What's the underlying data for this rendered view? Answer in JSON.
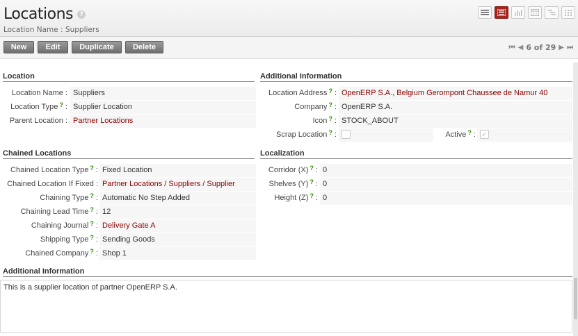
{
  "header": {
    "title": "Locations",
    "help_icon": "?",
    "breadcrumb": "Location Name : Suppliers"
  },
  "view_switcher": [
    "list-view-icon",
    "form-view-icon",
    "graph-view-icon",
    "calendar-view-icon",
    "gantt-view-icon",
    "kanban-view-icon"
  ],
  "toolbar": {
    "new_label": "New",
    "edit_label": "Edit",
    "duplicate_label": "Duplicate",
    "delete_label": "Delete"
  },
  "pager": {
    "first": "⏮",
    "prev": "◀",
    "status": "6 of 29",
    "next": "▶",
    "last": "⏭"
  },
  "location": {
    "section_title": "Location",
    "name_label": "Location Name :",
    "name_value": "Suppliers",
    "type_label": "Location Type",
    "type_value": "Supplier Location",
    "parent_label": "Parent Location :",
    "parent_value": "Partner Locations"
  },
  "additional_info": {
    "section_title": "Additional Information",
    "address_label": "Location Address",
    "address_value": "OpenERP S.A., Belgium Gerompont Chaussee de Namur 40",
    "company_label": "Company",
    "company_value": "OpenERP S.A.",
    "icon_label": "Icon",
    "icon_value": "STOCK_ABOUT",
    "scrap_label": "Scrap Location",
    "scrap_checked": false,
    "active_label": "Active",
    "active_checked": true
  },
  "chained": {
    "section_title": "Chained Locations",
    "type_label": "Chained Location Type",
    "type_value": "Fixed Location",
    "fixed_label": "Chained Location If Fixed :",
    "fixed_value": "Partner Locations / Suppliers / Supplier",
    "chaining_type_label": "Chaining Type",
    "chaining_type_value": "Automatic No Step Added",
    "lead_time_label": "Chaining Lead Time",
    "lead_time_value": "12",
    "journal_label": "Chaining Journal",
    "journal_value": "Delivery Gate A",
    "shipping_label": "Shipping Type",
    "shipping_value": "Sending Goods",
    "company_label": "Chained Company",
    "company_value": "Shop 1"
  },
  "localization": {
    "section_title": "Localization",
    "corridor_label": "Corridor (X)",
    "corridor_value": "0",
    "shelves_label": "Shelves (Y)",
    "shelves_value": "0",
    "height_label": "Height (Z)",
    "height_value": "0"
  },
  "notes": {
    "section_title": "Additional Information",
    "text": "This is a supplier location of partner OpenERP S.A."
  },
  "colors": {
    "accent": "#a8231b",
    "link": "#8b0000",
    "help_green": "#2d8a00"
  }
}
